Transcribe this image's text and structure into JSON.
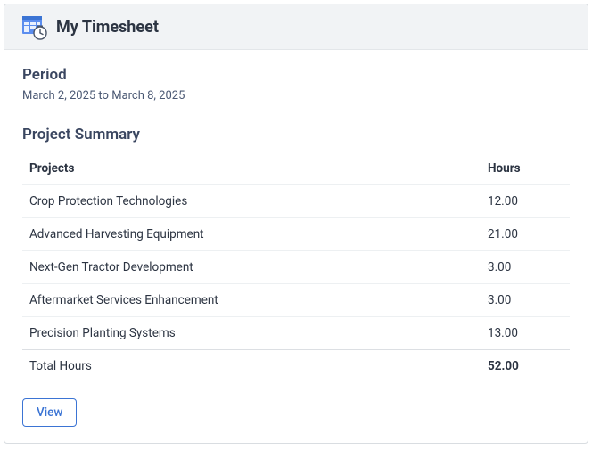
{
  "header": {
    "title": "My Timesheet"
  },
  "period": {
    "heading": "Period",
    "text": "March 2, 2025 to March 8, 2025"
  },
  "summary": {
    "heading": "Project Summary",
    "columns": {
      "project": "Projects",
      "hours": "Hours"
    },
    "rows": [
      {
        "project": "Crop Protection Technologies",
        "hours": "12.00"
      },
      {
        "project": "Advanced Harvesting Equipment",
        "hours": "21.00"
      },
      {
        "project": "Next-Gen Tractor Development",
        "hours": "3.00"
      },
      {
        "project": "Aftermarket Services Enhancement",
        "hours": "3.00"
      },
      {
        "project": "Precision Planting Systems",
        "hours": "13.00"
      }
    ],
    "total": {
      "label": "Total Hours",
      "hours": "52.00"
    }
  },
  "actions": {
    "view": "View"
  }
}
